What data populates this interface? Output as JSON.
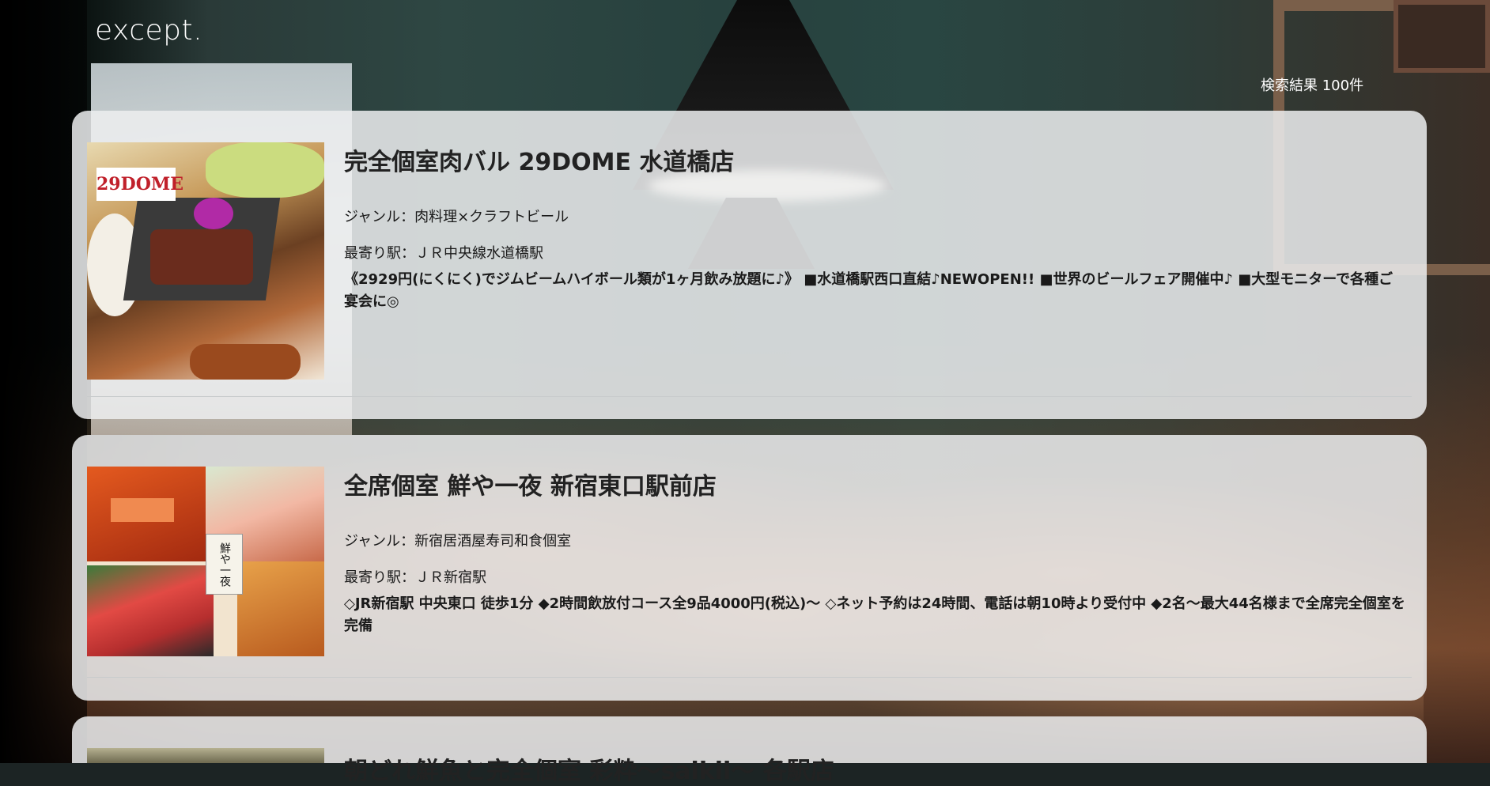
{
  "header": {
    "logo": "except.",
    "result_count": "検索結果 100件"
  },
  "results": [
    {
      "name": "完全個室肉バル 29DOME 水道橋店",
      "genre": "ジャンル：肉料理×クラフトビール",
      "station": "最寄り駅：ＪＲ中央線水道橋駅",
      "description": "《2929円(にくにく)でジムビームハイボール類が1ヶ月飲み放題に♪》 ■水道橋駅西口直結♪NEWOPEN!! ■世界のビールフェア開催中♪ ■大型モニターで各種ご宴会に◎",
      "image_brand": "29DOME"
    },
    {
      "name": "全席個室 鮮や一夜 新宿東口駅前店",
      "genre": "ジャンル：新宿居酒屋寿司和食個室",
      "station": "最寄り駅：ＪＲ新宿駅",
      "description": "◇JR新宿駅 中央東口 徒歩1分 ◆2時間飲放付コース全9品4000円(税込)～ ◇ネット予約は24時間、電話は朝10時より受付中 ◆2名～最大44名様まで全席完全個室を完備",
      "image_label": "鮮や一夜"
    },
    {
      "name": "朝どれ鮮魚と完全個室 彩粋～saikii～ 各駅店"
    }
  ]
}
